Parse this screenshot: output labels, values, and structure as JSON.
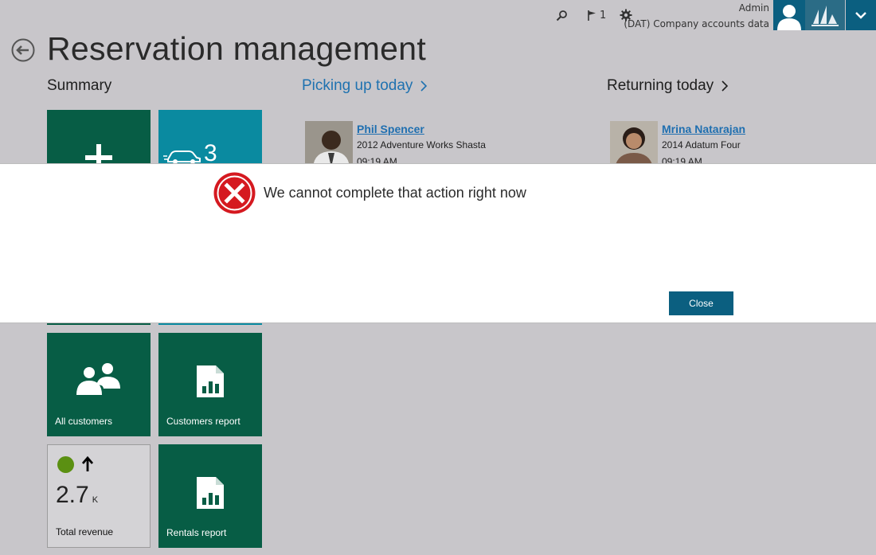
{
  "header": {
    "admin": "Admin",
    "company": "(DAT) Company accounts data",
    "notification_count": "1"
  },
  "page": {
    "title": "Reservation management"
  },
  "summary": {
    "heading": "Summary",
    "tiles": [
      {
        "label": ""
      },
      {
        "label": "",
        "count": "3"
      },
      {
        "label": "All customers"
      },
      {
        "label": "Customers report"
      },
      {
        "label": "Rentals report"
      }
    ],
    "kpi": {
      "value": "2.7",
      "unit": "K",
      "label": "Total revenue",
      "status_color": "#5b9012",
      "trend": "up"
    }
  },
  "picking_up": {
    "heading": "Picking up today",
    "people": [
      {
        "name": "Phil Spencer",
        "car": "2012 Adventure Works Shasta",
        "time": "09:19 AM"
      }
    ]
  },
  "returning": {
    "heading": "Returning today",
    "people": [
      {
        "name": "Mrina Natarajan",
        "car": "2014 Adatum Four",
        "time": "09:19 AM"
      }
    ]
  },
  "dialog": {
    "message": "We cannot complete that action right now",
    "close_label": "Close"
  },
  "colors": {
    "background": "#c8c6ca",
    "tile_green": "#075d45",
    "tile_teal": "#0a8aa0",
    "accent_blue": "#1f72b0",
    "error_red": "#d51920"
  }
}
